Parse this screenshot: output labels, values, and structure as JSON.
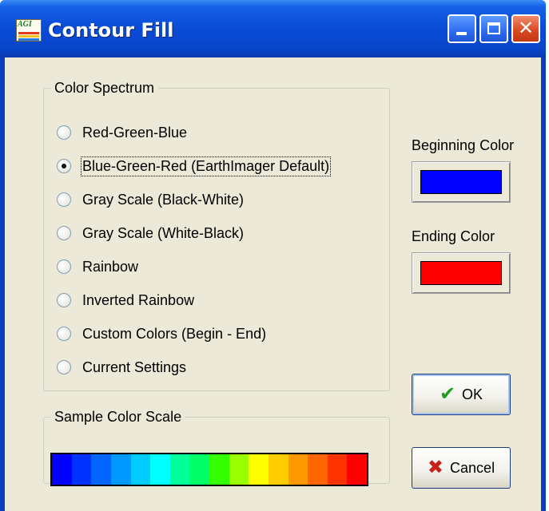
{
  "window": {
    "title": "Contour Fill",
    "app_icon": {
      "name": "agi-app-icon",
      "text": "AGI"
    },
    "controls": [
      {
        "name": "minimize-button",
        "icon": "minimize-icon"
      },
      {
        "name": "maximize-button",
        "icon": "maximize-icon"
      },
      {
        "name": "close-button",
        "icon": "close-icon",
        "glyph": "✕"
      }
    ]
  },
  "color_spectrum": {
    "legend": "Color Spectrum",
    "selected_index": 1,
    "options": [
      {
        "label": "Red-Green-Blue"
      },
      {
        "label": "Blue-Green-Red (EarthImager Default)"
      },
      {
        "label": "Gray Scale (Black-White)"
      },
      {
        "label": "Gray Scale (White-Black)"
      },
      {
        "label": "Rainbow"
      },
      {
        "label": "Inverted Rainbow"
      },
      {
        "label": "Custom Colors (Begin - End)"
      },
      {
        "label": "Current Settings"
      }
    ]
  },
  "beginning_color": {
    "label": "Beginning Color",
    "color": "#0000ff"
  },
  "ending_color": {
    "label": "Ending Color",
    "color": "#ff0000"
  },
  "ok_button": {
    "label": "OK",
    "icon": "checkmark-icon",
    "glyph": "✔",
    "icon_color": "#1e9e1e"
  },
  "cancel_button": {
    "label": "Cancel",
    "icon": "red-x-icon",
    "glyph": "✖",
    "icon_color": "#c8201a"
  },
  "sample_scale": {
    "legend": "Sample Color Scale",
    "colors": [
      "#0000ff",
      "#0033ff",
      "#0066ff",
      "#0099ff",
      "#00ccff",
      "#00ffff",
      "#00ff99",
      "#00ff66",
      "#33ff00",
      "#99ff00",
      "#ffff00",
      "#ffcc00",
      "#ff9900",
      "#ff6600",
      "#ff3300",
      "#ff0000"
    ]
  },
  "colors": {
    "window_frame": "#0a3fbf",
    "dialog_background": "#ece9d8"
  }
}
